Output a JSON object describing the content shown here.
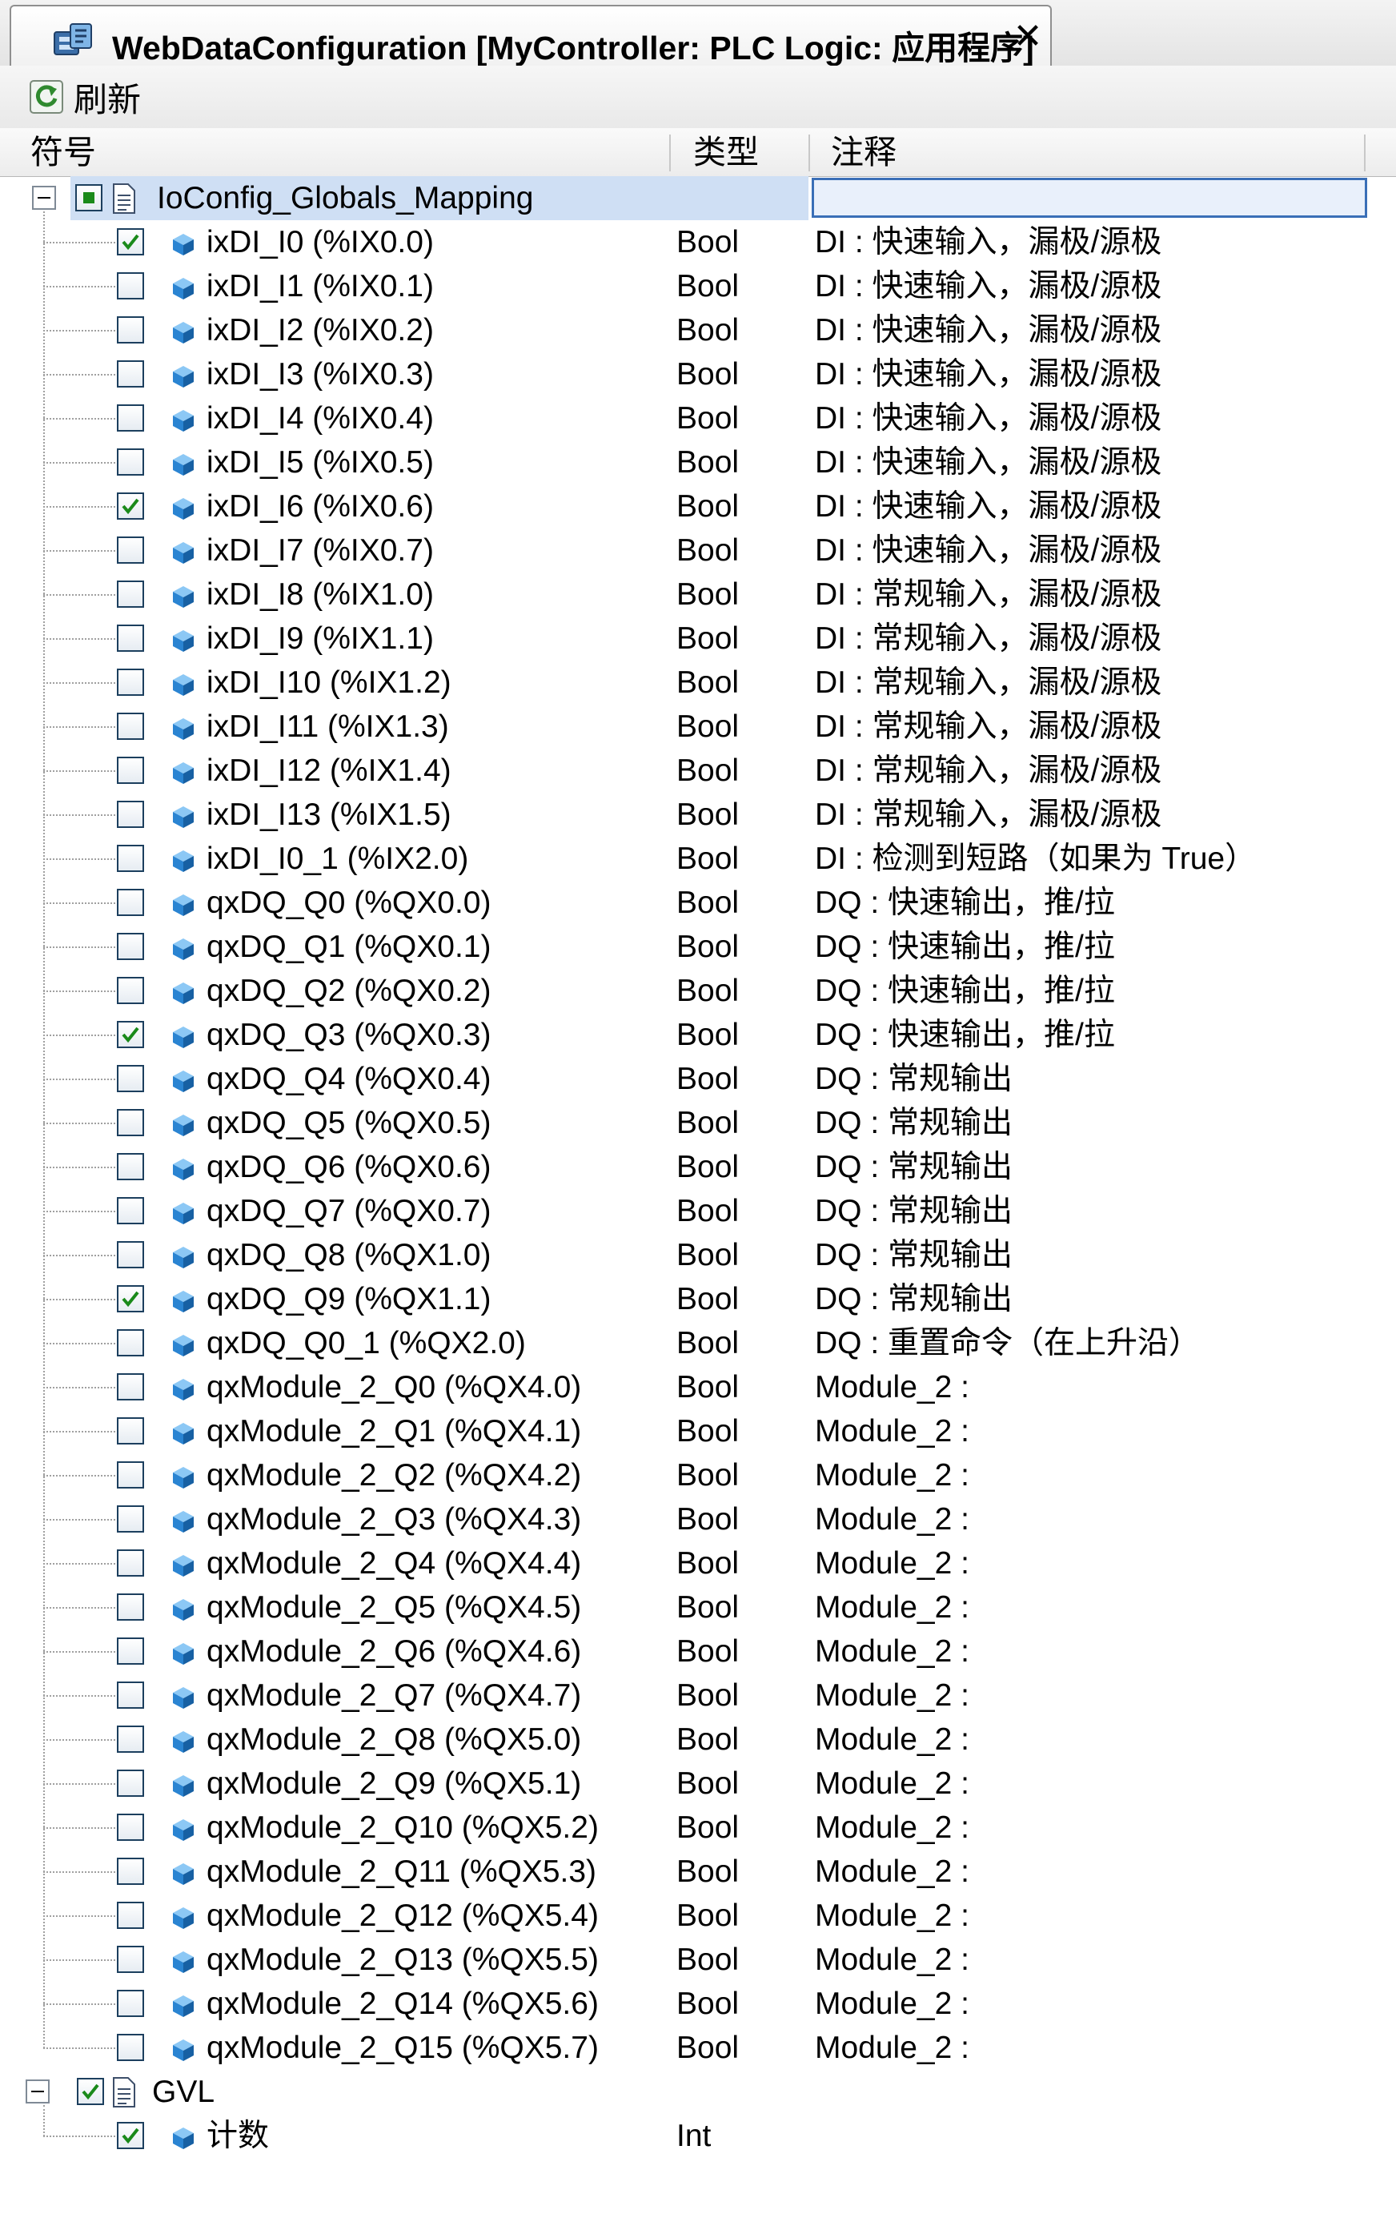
{
  "tab": {
    "title": "WebDataConfiguration [MyController: PLC Logic: 应用程序]",
    "close_glyph": "✕",
    "icon": "plc-config-icon"
  },
  "toolbar": {
    "refresh_label": "刷新",
    "refresh_icon": "refresh-icon"
  },
  "columns": {
    "symbol": "符号",
    "type": "类型",
    "comment": "注释"
  },
  "groups": [
    {
      "name": "IoConfig_Globals_Mapping",
      "checkbox_state": "partial",
      "comment": "",
      "variables": [
        {
          "symbol": "ixDI_I0 (%IX0.0)",
          "type": "Bool",
          "comment": "DI : 快速输入，漏极/源极",
          "checked": true
        },
        {
          "symbol": "ixDI_I1 (%IX0.1)",
          "type": "Bool",
          "comment": "DI : 快速输入，漏极/源极",
          "checked": false
        },
        {
          "symbol": "ixDI_I2 (%IX0.2)",
          "type": "Bool",
          "comment": "DI : 快速输入，漏极/源极",
          "checked": false
        },
        {
          "symbol": "ixDI_I3 (%IX0.3)",
          "type": "Bool",
          "comment": "DI : 快速输入，漏极/源极",
          "checked": false
        },
        {
          "symbol": "ixDI_I4 (%IX0.4)",
          "type": "Bool",
          "comment": "DI : 快速输入，漏极/源极",
          "checked": false
        },
        {
          "symbol": "ixDI_I5 (%IX0.5)",
          "type": "Bool",
          "comment": "DI : 快速输入，漏极/源极",
          "checked": false
        },
        {
          "symbol": "ixDI_I6 (%IX0.6)",
          "type": "Bool",
          "comment": "DI : 快速输入，漏极/源极",
          "checked": true
        },
        {
          "symbol": "ixDI_I7 (%IX0.7)",
          "type": "Bool",
          "comment": "DI : 快速输入，漏极/源极",
          "checked": false
        },
        {
          "symbol": "ixDI_I8 (%IX1.0)",
          "type": "Bool",
          "comment": "DI : 常规输入，漏极/源极",
          "checked": false
        },
        {
          "symbol": "ixDI_I9 (%IX1.1)",
          "type": "Bool",
          "comment": "DI : 常规输入，漏极/源极",
          "checked": false
        },
        {
          "symbol": "ixDI_I10 (%IX1.2)",
          "type": "Bool",
          "comment": "DI : 常规输入，漏极/源极",
          "checked": false
        },
        {
          "symbol": "ixDI_I11 (%IX1.3)",
          "type": "Bool",
          "comment": "DI : 常规输入，漏极/源极",
          "checked": false
        },
        {
          "symbol": "ixDI_I12 (%IX1.4)",
          "type": "Bool",
          "comment": "DI : 常规输入，漏极/源极",
          "checked": false
        },
        {
          "symbol": "ixDI_I13 (%IX1.5)",
          "type": "Bool",
          "comment": "DI : 常规输入，漏极/源极",
          "checked": false
        },
        {
          "symbol": "ixDI_I0_1 (%IX2.0)",
          "type": "Bool",
          "comment": "DI : 检测到短路（如果为 True）",
          "checked": false
        },
        {
          "symbol": "qxDQ_Q0 (%QX0.0)",
          "type": "Bool",
          "comment": "DQ : 快速输出，推/拉",
          "checked": false
        },
        {
          "symbol": "qxDQ_Q1 (%QX0.1)",
          "type": "Bool",
          "comment": "DQ : 快速输出，推/拉",
          "checked": false
        },
        {
          "symbol": "qxDQ_Q2 (%QX0.2)",
          "type": "Bool",
          "comment": "DQ : 快速输出，推/拉",
          "checked": false
        },
        {
          "symbol": "qxDQ_Q3 (%QX0.3)",
          "type": "Bool",
          "comment": "DQ : 快速输出，推/拉",
          "checked": true
        },
        {
          "symbol": "qxDQ_Q4 (%QX0.4)",
          "type": "Bool",
          "comment": "DQ : 常规输出",
          "checked": false
        },
        {
          "symbol": "qxDQ_Q5 (%QX0.5)",
          "type": "Bool",
          "comment": "DQ : 常规输出",
          "checked": false
        },
        {
          "symbol": "qxDQ_Q6 (%QX0.6)",
          "type": "Bool",
          "comment": "DQ : 常规输出",
          "checked": false
        },
        {
          "symbol": "qxDQ_Q7 (%QX0.7)",
          "type": "Bool",
          "comment": "DQ : 常规输出",
          "checked": false
        },
        {
          "symbol": "qxDQ_Q8 (%QX1.0)",
          "type": "Bool",
          "comment": "DQ : 常规输出",
          "checked": false
        },
        {
          "symbol": "qxDQ_Q9 (%QX1.1)",
          "type": "Bool",
          "comment": "DQ : 常规输出",
          "checked": true
        },
        {
          "symbol": "qxDQ_Q0_1 (%QX2.0)",
          "type": "Bool",
          "comment": "DQ : 重置命令（在上升沿）",
          "checked": false
        },
        {
          "symbol": "qxModule_2_Q0 (%QX4.0)",
          "type": "Bool",
          "comment": "Module_2 :",
          "checked": false
        },
        {
          "symbol": "qxModule_2_Q1 (%QX4.1)",
          "type": "Bool",
          "comment": "Module_2 :",
          "checked": false
        },
        {
          "symbol": "qxModule_2_Q2 (%QX4.2)",
          "type": "Bool",
          "comment": "Module_2 :",
          "checked": false
        },
        {
          "symbol": "qxModule_2_Q3 (%QX4.3)",
          "type": "Bool",
          "comment": "Module_2 :",
          "checked": false
        },
        {
          "symbol": "qxModule_2_Q4 (%QX4.4)",
          "type": "Bool",
          "comment": "Module_2 :",
          "checked": false
        },
        {
          "symbol": "qxModule_2_Q5 (%QX4.5)",
          "type": "Bool",
          "comment": "Module_2 :",
          "checked": false
        },
        {
          "symbol": "qxModule_2_Q6 (%QX4.6)",
          "type": "Bool",
          "comment": "Module_2 :",
          "checked": false
        },
        {
          "symbol": "qxModule_2_Q7 (%QX4.7)",
          "type": "Bool",
          "comment": "Module_2 :",
          "checked": false
        },
        {
          "symbol": "qxModule_2_Q8 (%QX5.0)",
          "type": "Bool",
          "comment": "Module_2 :",
          "checked": false
        },
        {
          "symbol": "qxModule_2_Q9 (%QX5.1)",
          "type": "Bool",
          "comment": "Module_2 :",
          "checked": false
        },
        {
          "symbol": "qxModule_2_Q10 (%QX5.2)",
          "type": "Bool",
          "comment": "Module_2 :",
          "checked": false
        },
        {
          "symbol": "qxModule_2_Q11 (%QX5.3)",
          "type": "Bool",
          "comment": "Module_2 :",
          "checked": false
        },
        {
          "symbol": "qxModule_2_Q12 (%QX5.4)",
          "type": "Bool",
          "comment": "Module_2 :",
          "checked": false
        },
        {
          "symbol": "qxModule_2_Q13 (%QX5.5)",
          "type": "Bool",
          "comment": "Module_2 :",
          "checked": false
        },
        {
          "symbol": "qxModule_2_Q14 (%QX5.6)",
          "type": "Bool",
          "comment": "Module_2 :",
          "checked": false
        },
        {
          "symbol": "qxModule_2_Q15 (%QX5.7)",
          "type": "Bool",
          "comment": "Module_2 :",
          "checked": false
        }
      ]
    },
    {
      "name": "GVL",
      "checkbox_state": "checked",
      "comment": "",
      "variables": [
        {
          "symbol": "计数",
          "type": "Int",
          "comment": "",
          "checked": true
        }
      ]
    }
  ],
  "colors": {
    "selection": "#cfdff4",
    "edit_border": "#3a6fb7",
    "checkbox_border": "#1c3f5e",
    "check_mark": "#1a8a1a",
    "variable_icon": "#2a84d2"
  }
}
